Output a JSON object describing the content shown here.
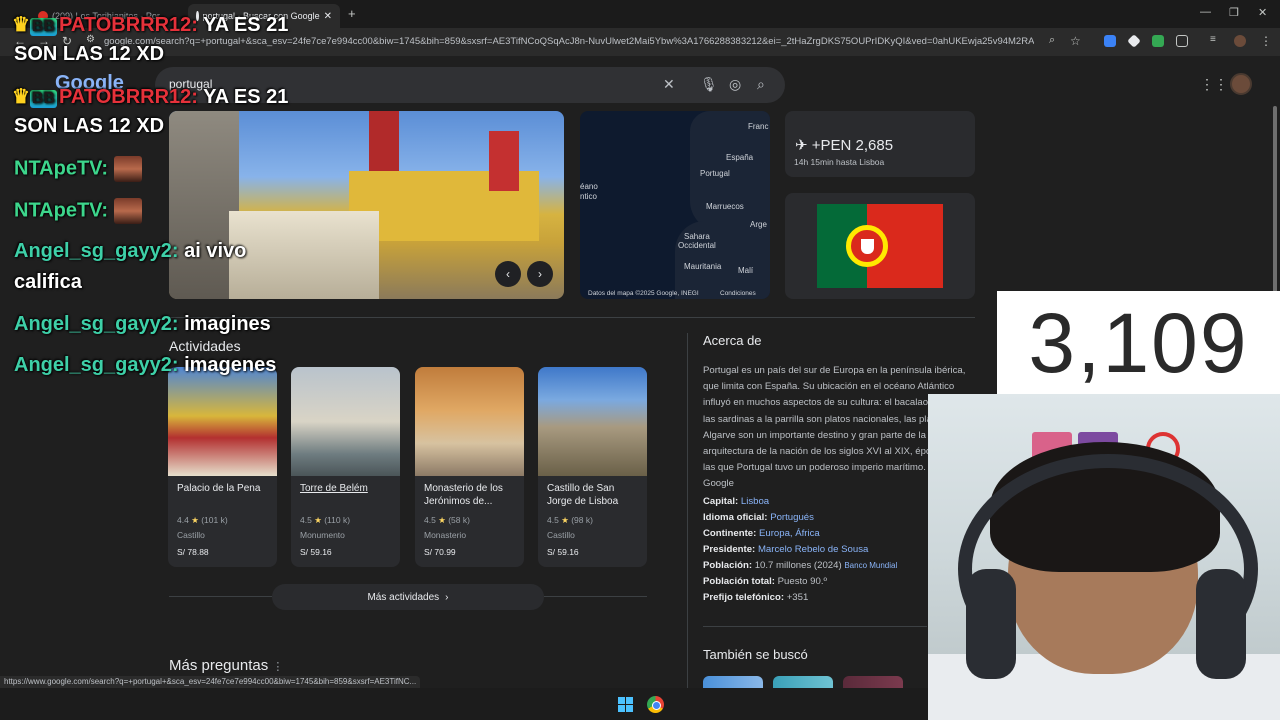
{
  "browser": {
    "tabs": [
      {
        "title": "(209) Los Torihianitos - Por"
      },
      {
        "title": "portugal - Buscar con Google"
      }
    ],
    "new_tab": "+",
    "window_controls": [
      "—",
      "❐",
      "✕"
    ],
    "url": "google.com/search?q=+portugal+&sca_esv=24fe7ce7e994cc00&biw=1745&bih=859&sxsrf=AE3TifNCoQSqAcJ8n-NuvUlwet2Mai5Ybw%3A1766288383212&ei=_2tHaZrgDKS75OUPrIDKyQI&ved=0ahUKEwja25v94M2RAxWkH..."
  },
  "search": {
    "query": "portugal",
    "logo": "Google"
  },
  "carousel": {
    "prev": "‹",
    "next": "›"
  },
  "map": {
    "labels": [
      "Franc",
      "España",
      "Portugal",
      "éano",
      "ntico",
      "Marruecos",
      "Arge",
      "Sahara",
      "Occidental",
      "Mauritania",
      "Malí"
    ],
    "attribution": "Datos del mapa ©2025 Google, INEGI",
    "conditions": "Condiciones"
  },
  "flight": {
    "price": "+PEN 2,685",
    "duration": "14h 15min hasta Lisboa"
  },
  "activities": {
    "title": "Actividades",
    "items": [
      {
        "name": "Palacio de la Pena",
        "rating": "4.4",
        "reviews": "(101 k)",
        "type": "Castillo",
        "price": "S/ 78.88"
      },
      {
        "name": "Torre de Belém",
        "rating": "4.5",
        "reviews": "(110 k)",
        "type": "Monumento",
        "price": "S/ 59.16"
      },
      {
        "name": "Monasterio de los Jerónimos de...",
        "rating": "4.5",
        "reviews": "(58 k)",
        "type": "Monasterio",
        "price": "S/ 70.99"
      },
      {
        "name": "Castillo de San Jorge de Lisboa",
        "rating": "4.5",
        "reviews": "(98 k)",
        "type": "Castillo",
        "price": "S/ 59.16"
      }
    ],
    "more": "Más actividades"
  },
  "more_questions": "Más preguntas",
  "about": {
    "title": "Acerca de",
    "description": "Portugal es un país del sur de Europa en la península ibérica, que limita con España. Su ubicación en el océano Atlántico influyó en muchos aspectos de su cultura: el bacalao en sal y las sardinas a la parrilla son platos nacionales, las playas del Algarve son un importante destino y gran parte de la arquitectura de la nación de los siglos XVI al XIX, épocas en las que Portugal tuvo un poderoso imperio marítimo. — Google",
    "facts": [
      {
        "label": "Capital:",
        "value": "Lisboa",
        "link": true
      },
      {
        "label": "Idioma oficial:",
        "value": "Portugués",
        "link": true
      },
      {
        "label": "Continente:",
        "value": "Europa, África",
        "link": true
      },
      {
        "label": "Presidente:",
        "value": "Marcelo Rebelo de Sousa",
        "link": true
      },
      {
        "label": "Población:",
        "value": "10.7 millones (2024)",
        "extra": "Banco Mundial"
      },
      {
        "label": "Población total:",
        "value": "Puesto 90.º"
      },
      {
        "label": "Prefijo telefónico:",
        "value": "+351"
      }
    ],
    "also_searched": "También se buscó"
  },
  "status_url": "https://www.google.com/search?q=+portugal+&sca_esv=24fe7ce7e994cc00&biw=1745&bih=859&sxsrf=AE3TifNC...",
  "overlay": {
    "chat": [
      {
        "user": "PATOBRRR12:",
        "message": "YA ES 21",
        "badge": "BB"
      },
      {
        "continuation": "SON LAS 12 XD"
      },
      {
        "user": "PATOBRRR12:",
        "message": "YA ES 21",
        "badge": "BB"
      },
      {
        "continuation": "SON LAS 12 XD"
      },
      {
        "user": "NTApeTV:"
      },
      {
        "user": "NTApeTV:"
      },
      {
        "user": "Angel_sg_gayy2:",
        "message": "ai vivo"
      },
      {
        "continuation": "califica"
      },
      {
        "user": "Angel_sg_gayy2:",
        "message": "imagines"
      },
      {
        "user": "Angel_sg_gayy2:",
        "message": "imagenes"
      }
    ],
    "counter": "3,109"
  }
}
